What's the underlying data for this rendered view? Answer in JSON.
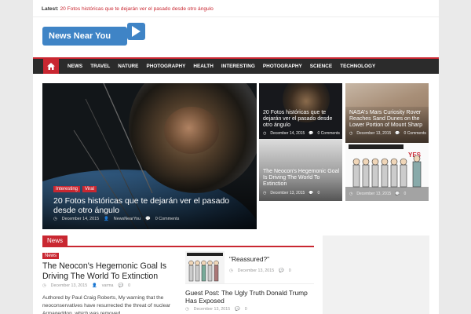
{
  "latest": {
    "label": "Latest:",
    "link": "20 Fotos históricas que te dejarán ver el pasado desde otro ángulo"
  },
  "logo": {
    "text": "News Near You"
  },
  "nav": {
    "items": [
      "NEWS",
      "TRAVEL",
      "NATURE",
      "PHOTOGRAPHY",
      "HEALTH",
      "INTERESTING",
      "PHOTOGRAPHY",
      "SCIENCE",
      "TECHNOLOGY"
    ]
  },
  "hero": {
    "tags": [
      "Interesting",
      "Viral"
    ],
    "title": "20 Fotos históricas que te dejarán ver el pasado desde otro ángulo",
    "date": "December 14, 2015",
    "author": "NewsNearYou",
    "comments": "0 Comments"
  },
  "tiles": [
    {
      "title": "20 Fotos históricas que te dejarán ver el pasado desde otro ángulo",
      "date": "December 14, 2015",
      "comments": "0 Comments"
    },
    {
      "title": "NASA's Mars Curiosity Rover Reaches Sand Dunes on the Lower Portion of Mount Sharp",
      "date": "December 13, 2015",
      "comments": "0 Comments"
    },
    {
      "title": "The Neocon's Hegemonic Goal Is Driving The World To Extinction",
      "date": "December 13, 2015",
      "comments": "0"
    },
    {
      "date": "December 13, 2015",
      "comments": "0"
    }
  ],
  "section": {
    "label": "News"
  },
  "article1": {
    "tag": "News",
    "title": "The Neocon's Hegemonic Goal Is Driving The World To Extinction",
    "date": "December 13, 2015",
    "author": "varma",
    "comments": "0",
    "excerpt": "Authored by Paul Craig Roberts, My warning that the neoconservatives have resurrected the threat of nuclear Armageddon, which was removed"
  },
  "article2": {
    "title": "\"Reassured?\"",
    "date": "December 13, 2015",
    "comments": "0"
  },
  "article3": {
    "title": "Guest Post: The Ugly Truth Donald Trump Has Exposed",
    "date": "December 13, 2015",
    "comments": "0"
  },
  "colors": {
    "accent": "#c92731",
    "nav_bg": "#2b2b2b",
    "logo_blue": "#3f84c6"
  }
}
